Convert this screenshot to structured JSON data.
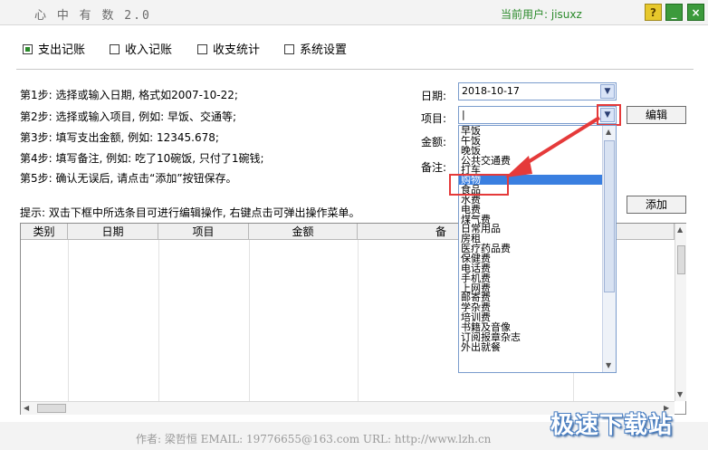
{
  "titlebar": {
    "app_title": "心 中 有 数  2.0",
    "user_label": "当前用户: jisuxz",
    "help_label": "?",
    "minimize_label": "_",
    "close_label": "×"
  },
  "tabs": [
    {
      "label": "支出记账",
      "checked": true
    },
    {
      "label": "收入记账",
      "checked": false
    },
    {
      "label": "收支统计",
      "checked": false
    },
    {
      "label": "系统设置",
      "checked": false
    }
  ],
  "steps": [
    "第1步: 选择或输入日期, 格式如2007-10-22;",
    "第2步: 选择或输入项目, 例如: 早饭、交通等;",
    "第3步: 填写支出金额, 例如: 12345.678;",
    "第4步: 填写备注, 例如: 吃了10碗饭, 只付了1碗钱;",
    "第5步: 确认无误后, 请点击“添加”按钮保存。"
  ],
  "form": {
    "date_label": "日期:",
    "date_value": "2018-10-17",
    "item_label": "项目:",
    "item_value": "|",
    "amount_label": "金额:",
    "note_label": "备注:",
    "edit_button": "编辑",
    "add_button": "添加"
  },
  "hint": "提示: 双击下框中所选条目可进行编辑操作, 右键点击可弹出操作菜单。",
  "table": {
    "headers": [
      "类别",
      "日期",
      "项目",
      "金额",
      "备"
    ]
  },
  "dropdown": {
    "items": [
      "早饭",
      "午饭",
      "晚饭",
      "公共交通费",
      "打车",
      "购物",
      "食品",
      "水费",
      "电费",
      "煤气费",
      "日常用品",
      "房租",
      "医疗药品费",
      "保健费",
      "电话费",
      "手机费",
      "上网费",
      "邮寄费",
      "学杂费",
      "培训费",
      "书籍及音像",
      "订阅报章杂志",
      "外出就餐"
    ],
    "selected": "购物"
  },
  "footer": {
    "text": "作者: 梁哲恒     EMAIL: 19776655@163.com     URL: http://www.lzh.cn"
  },
  "watermark": "极速下载站",
  "colors": {
    "accent": "#3a7fe0",
    "highlight": "#e53a3a",
    "user_text": "#2a8a2a"
  }
}
